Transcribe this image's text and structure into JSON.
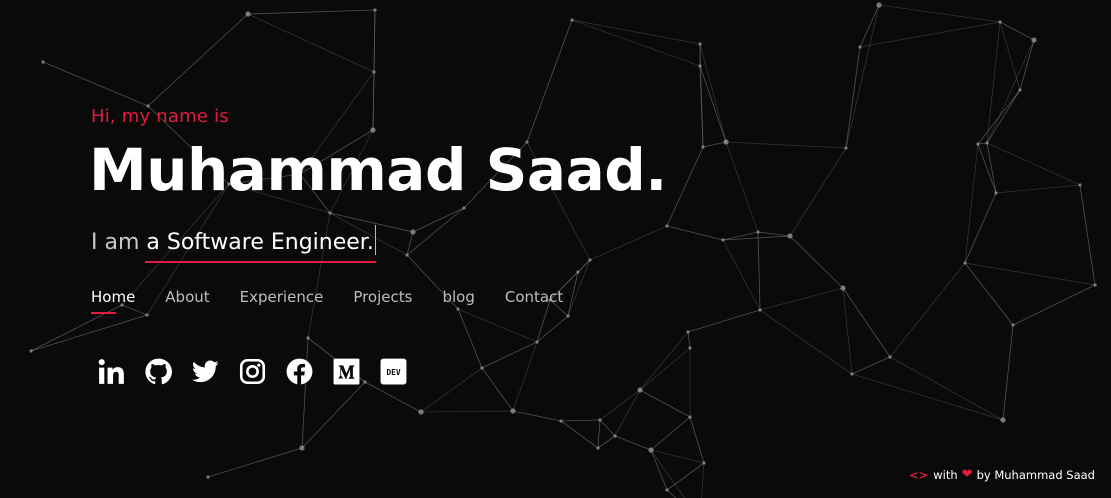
{
  "colors": {
    "accent": "#e31b3f",
    "background": "#0a0a0a",
    "network": "#9a9a9a"
  },
  "hero": {
    "greeting": "Hi, my name is",
    "name": "Muhammad Saad.",
    "tagline_prefix": "I am",
    "tagline_role": "a Software Engineer."
  },
  "nav": {
    "items": [
      {
        "label": "Home",
        "active": true
      },
      {
        "label": "About",
        "active": false
      },
      {
        "label": "Experience",
        "active": false
      },
      {
        "label": "Projects",
        "active": false
      },
      {
        "label": "blog",
        "active": false
      },
      {
        "label": "Contact",
        "active": false
      }
    ]
  },
  "social": [
    {
      "icon": "linkedin-icon"
    },
    {
      "icon": "github-icon"
    },
    {
      "icon": "twitter-icon"
    },
    {
      "icon": "instagram-icon"
    },
    {
      "icon": "facebook-icon"
    },
    {
      "icon": "medium-icon"
    },
    {
      "icon": "dev-icon",
      "text": "DEV"
    }
  ],
  "footer": {
    "code_symbol": "<>",
    "with": "with",
    "by_text": "by Muhammad Saad"
  }
}
